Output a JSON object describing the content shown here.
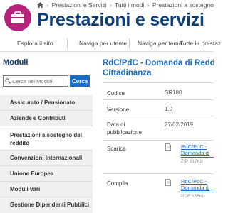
{
  "header": {
    "breadcrumb": [
      "Prestazioni e Servizi",
      "Tutti i modi",
      "Prestazioni a sostegno del reddito"
    ],
    "title": "Prestazioni e servizi",
    "nav": [
      "Esplora il sito",
      "Naviga per utente",
      "Naviga per tema",
      "Tutte le prestaz"
    ]
  },
  "sidebar": {
    "title": "Moduli",
    "search": {
      "placeholder": "Cerca nei Moduli",
      "button_label": "Cerca"
    },
    "items": [
      {
        "label": "Assicurato / Pensionato",
        "active": false
      },
      {
        "label": "Aziende e Contributi",
        "active": false
      },
      {
        "label": "Prestazioni a sostegno del reddito",
        "active": true
      },
      {
        "label": "Convenzioni Internazionali",
        "active": false
      },
      {
        "label": "Unione Europea",
        "active": false
      },
      {
        "label": "Moduli vari",
        "active": false
      },
      {
        "label": "Gestione Dipendenti Pubblici",
        "active": false,
        "expand": "+"
      }
    ]
  },
  "document": {
    "title": "RdC/PdC - Domanda di Reddito di Cittadinanza",
    "fields": {
      "codice": {
        "label": "Codice",
        "value": "SR180"
      },
      "versione": {
        "label": "Versione",
        "value": "1.0"
      },
      "data": {
        "label": "Data di pubblicazione",
        "value": "27/02/2019"
      },
      "scarica": {
        "label": "Scarica",
        "link": "RdC/PdC - Domanda di Reddito di Cittadinanza",
        "meta": "ZIP 317Kb"
      },
      "compila": {
        "label": "Compila",
        "link": "RdC/PdC - Domanda di Reddito di Cittadinanza",
        "meta": "PDF 336Kb"
      }
    }
  },
  "colors": {
    "brand": "#0b3d78",
    "link": "#1a6ec5",
    "logo": "#b5247a",
    "menu_bg": "#eef0f2"
  }
}
